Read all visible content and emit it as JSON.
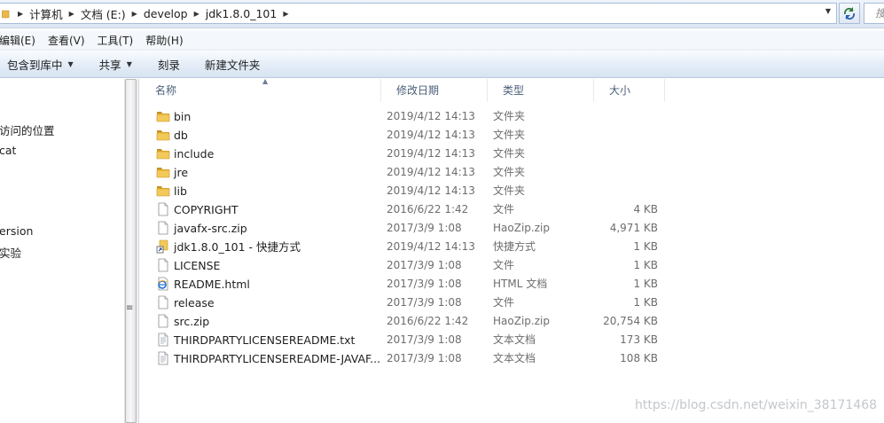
{
  "address": {
    "crumbs": [
      "计算机",
      "文档 (E:)",
      "develop",
      "jdk1.8.0_101"
    ],
    "search_placeholder": "搜"
  },
  "menubar": {
    "items": [
      "编辑(E)",
      "查看(V)",
      "工具(T)",
      "帮助(H)"
    ]
  },
  "toolbar": {
    "include_library": "包含到库中",
    "share": "共享",
    "burn": "刻录",
    "new_folder": "新建文件夹"
  },
  "nav": {
    "items": [
      "访问的位置",
      "cat",
      "ersion",
      "实验"
    ]
  },
  "columns": {
    "name": "名称",
    "date": "修改日期",
    "type": "类型",
    "size": "大小"
  },
  "files": [
    {
      "name": "bin",
      "date": "2019/4/12 14:13",
      "type": "文件夹",
      "size": "",
      "icon": "folder-icon"
    },
    {
      "name": "db",
      "date": "2019/4/12 14:13",
      "type": "文件夹",
      "size": "",
      "icon": "folder-icon"
    },
    {
      "name": "include",
      "date": "2019/4/12 14:13",
      "type": "文件夹",
      "size": "",
      "icon": "folder-icon"
    },
    {
      "name": "jre",
      "date": "2019/4/12 14:13",
      "type": "文件夹",
      "size": "",
      "icon": "folder-icon"
    },
    {
      "name": "lib",
      "date": "2019/4/12 14:13",
      "type": "文件夹",
      "size": "",
      "icon": "folder-icon"
    },
    {
      "name": "COPYRIGHT",
      "date": "2016/6/22 1:42",
      "type": "文件",
      "size": "4 KB",
      "icon": "file-icon"
    },
    {
      "name": "javafx-src.zip",
      "date": "2017/3/9 1:08",
      "type": "HaoZip.zip",
      "size": "4,971 KB",
      "icon": "file-icon"
    },
    {
      "name": "jdk1.8.0_101 - 快捷方式",
      "date": "2019/4/12 14:13",
      "type": "快捷方式",
      "size": "1 KB",
      "icon": "shortcut-icon"
    },
    {
      "name": "LICENSE",
      "date": "2017/3/9 1:08",
      "type": "文件",
      "size": "1 KB",
      "icon": "file-icon"
    },
    {
      "name": "README.html",
      "date": "2017/3/9 1:08",
      "type": "HTML 文档",
      "size": "1 KB",
      "icon": "ie-icon"
    },
    {
      "name": "release",
      "date": "2017/3/9 1:08",
      "type": "文件",
      "size": "1 KB",
      "icon": "file-icon"
    },
    {
      "name": "src.zip",
      "date": "2016/6/22 1:42",
      "type": "HaoZip.zip",
      "size": "20,754 KB",
      "icon": "file-icon"
    },
    {
      "name": "THIRDPARTYLICENSEREADME.txt",
      "date": "2017/3/9 1:08",
      "type": "文本文档",
      "size": "173 KB",
      "icon": "text-file-icon"
    },
    {
      "name": "THIRDPARTYLICENSEREADME-JAVAF...",
      "date": "2017/3/9 1:08",
      "type": "文本文档",
      "size": "108 KB",
      "icon": "text-file-icon"
    }
  ],
  "watermark": "https://blog.csdn.net/weixin_38171468",
  "colors": {
    "folder": "#e8b84a",
    "header_text": "#4c607a",
    "detail_text": "#6d6d6d"
  }
}
